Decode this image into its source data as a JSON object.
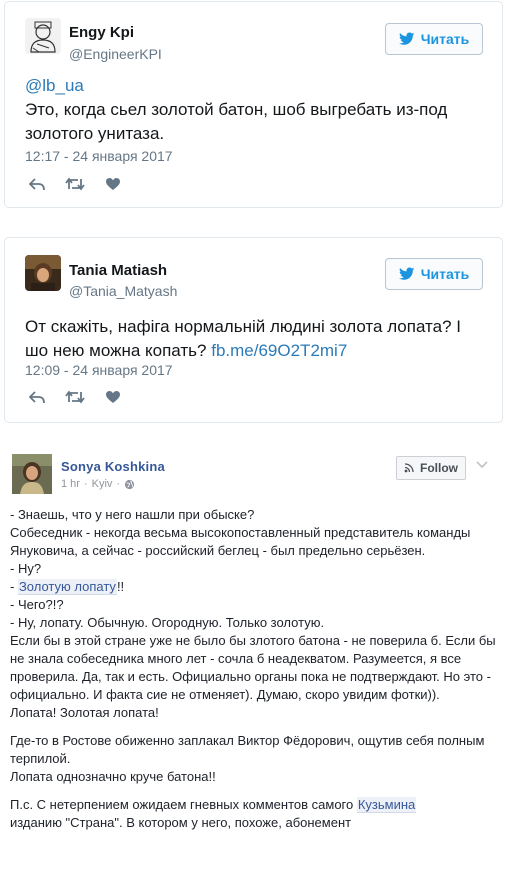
{
  "tweets": [
    {
      "name": "Engy Kpi",
      "handle": "@EngineerKPI",
      "follow_label": "Читать",
      "mention": "@lb_ua",
      "text": "Это, когда сьел золотой батон, шоб выгребать из-под золотого унитаза.",
      "time": "12:17 - 24 января 2017"
    },
    {
      "name": "Tania Matiash",
      "handle": "@Tania_Matyash",
      "follow_label": "Читать",
      "text": "От скажіть, нафіга нормальній людині золота лопата? І шо нею можна копать?",
      "link": "fb.me/69O2T2mi7",
      "time": "12:09 - 24 января 2017"
    }
  ],
  "fb": {
    "name": "Sonya Koshkina",
    "time": "1 hr",
    "location": "Kyiv",
    "separator": "·",
    "follow_label": "Follow",
    "lines": [
      "- Знаешь, что у него нашли при обыске?",
      "Собеседник - некогда весьма высокопоставленный представитель команды Януковича, а сейчас - российский беглец - был предельно серьёзен.",
      "- Ну?",
      "- Чего?!?",
      "- Ну, лопату. Обычную. Огородную. Только золотую.",
      "Если бы в этой стране уже не было бы злотого батона - не поверила б. Если бы не знала собеседника много лет - сочла б неадекватом. Разумеется, я все проверила. Да, так и есть. Официально органы пока не подтверждают. Но это - официально. И факта сие не отменяет). Думаю, скоро увидим фотки)).",
      "Лопата! Золотая лопата!",
      "Где-то в Ростове обиженно заплакал Виктор Фёдорович, ощутив себя полным терпилой.",
      "Лопата однозначно круче батона!!",
      "П.с. С нетерпением ожидаем гневных комментов самого",
      "изданию \"Страна\". В котором у него, похоже, абонемент"
    ],
    "golden_prefix": "- ",
    "golden_link": "Золотую лопату",
    "golden_suffix": "!!",
    "kuzmin_link": "Кузьмина"
  },
  "colors": {
    "twitter_blue": "#1b95e0",
    "link": "#2b7bb9",
    "fb_name": "#365899",
    "muted": "#657786"
  }
}
